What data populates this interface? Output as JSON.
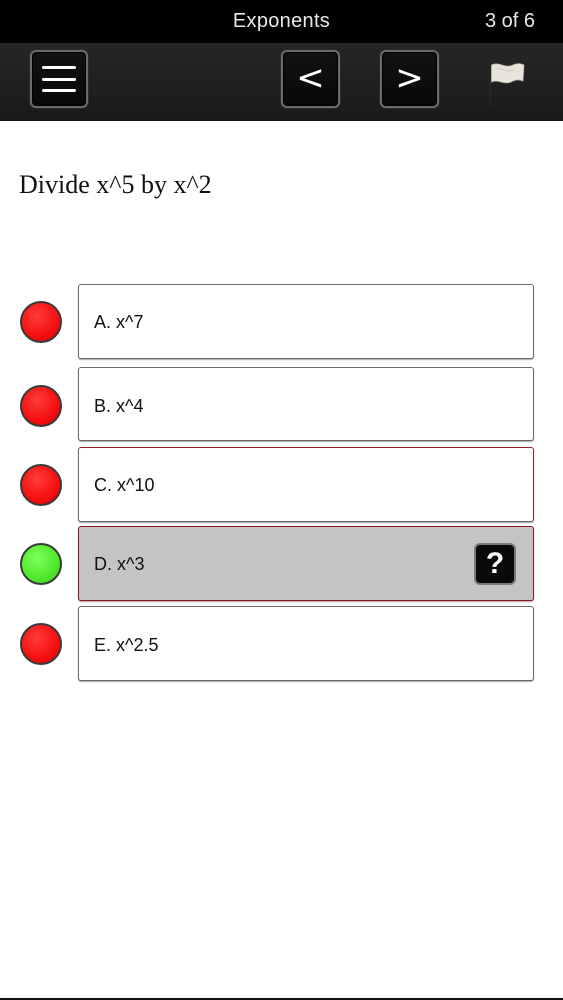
{
  "status": {
    "title": "Exponents",
    "progress": "3 of 6"
  },
  "toolbar": {
    "menu_icon": "hamburger-menu-icon",
    "prev_symbol": "<",
    "next_symbol": ">",
    "flag_icon": "flag-icon"
  },
  "question": {
    "text": "Divide x^5 by x^2"
  },
  "answers": [
    {
      "label": "A. x^7",
      "status": "incorrect",
      "indicator_color": "#f50f0f"
    },
    {
      "label": "B. x^4",
      "status": "incorrect",
      "indicator_color": "#f50f0f"
    },
    {
      "label": "C. x^10",
      "status": "incorrect",
      "indicator_color": "#f50f0f"
    },
    {
      "label": "D. x^3",
      "status": "correct",
      "selected": true,
      "indicator_color": "#4fe82a",
      "help_symbol": "?"
    },
    {
      "label": "E. x^2.5",
      "status": "incorrect",
      "indicator_color": "#f50f0f"
    }
  ]
}
